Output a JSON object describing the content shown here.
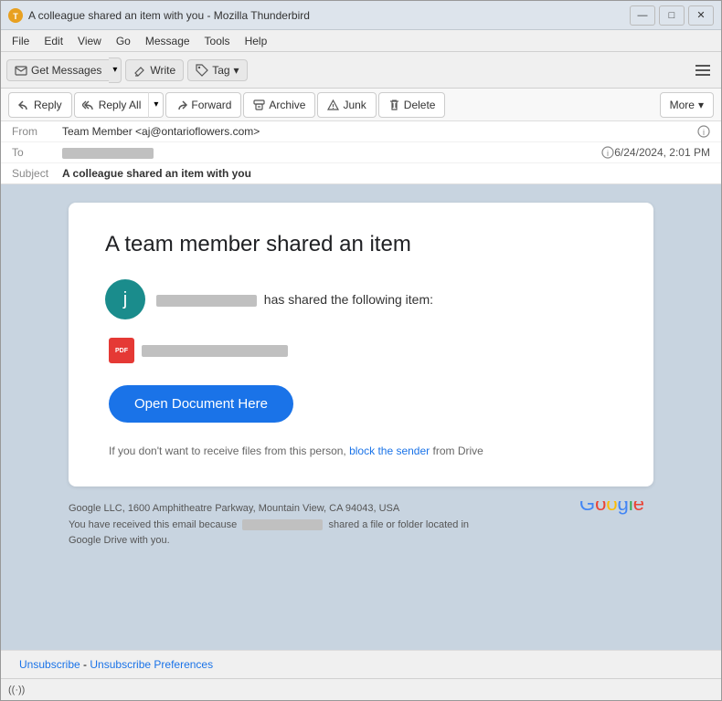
{
  "window": {
    "title": "A colleague shared an item with you - Mozilla Thunderbird",
    "icon": "T"
  },
  "title_controls": {
    "minimize": "—",
    "maximize": "□",
    "close": "✕"
  },
  "menu": {
    "items": [
      "File",
      "Edit",
      "View",
      "Go",
      "Message",
      "Tools",
      "Help"
    ]
  },
  "toolbar": {
    "get_messages": "Get Messages",
    "write": "Write",
    "tag": "Tag"
  },
  "email_actions": {
    "reply": "Reply",
    "reply_all": "Reply All",
    "forward": "Forward",
    "archive": "Archive",
    "junk": "Junk",
    "delete": "Delete",
    "more": "More"
  },
  "email_header": {
    "from_label": "From",
    "from_value": "Team Member <aj@ontarioflowers.com>",
    "to_label": "To",
    "subject_label": "Subject",
    "subject_value": "A colleague shared an item with you",
    "date": "6/24/2024, 2:01 PM"
  },
  "email_body": {
    "card_title": "A team member shared an item",
    "sender_letter": "j",
    "has_shared_text": "has shared the following item:",
    "open_btn_label": "Open Document Here",
    "footer_note_before": "If you don't want to receive files from this person,",
    "block_sender_link": "block the sender",
    "footer_note_after": "from Drive"
  },
  "email_footer": {
    "address_line1": "Google LLC, 1600 Amphitheatre Parkway, Mountain View, CA 94043, USA",
    "address_line2_before": "You have received this email because",
    "address_line2_after": "shared a file or folder located in",
    "address_line3": "Google Drive with you.",
    "logo": "Google"
  },
  "unsubscribe": {
    "text1": "Unsubscribe",
    "separator": " - ",
    "text2": "Unsubscribe Preferences"
  },
  "status_bar": {
    "icon": "((·))"
  }
}
